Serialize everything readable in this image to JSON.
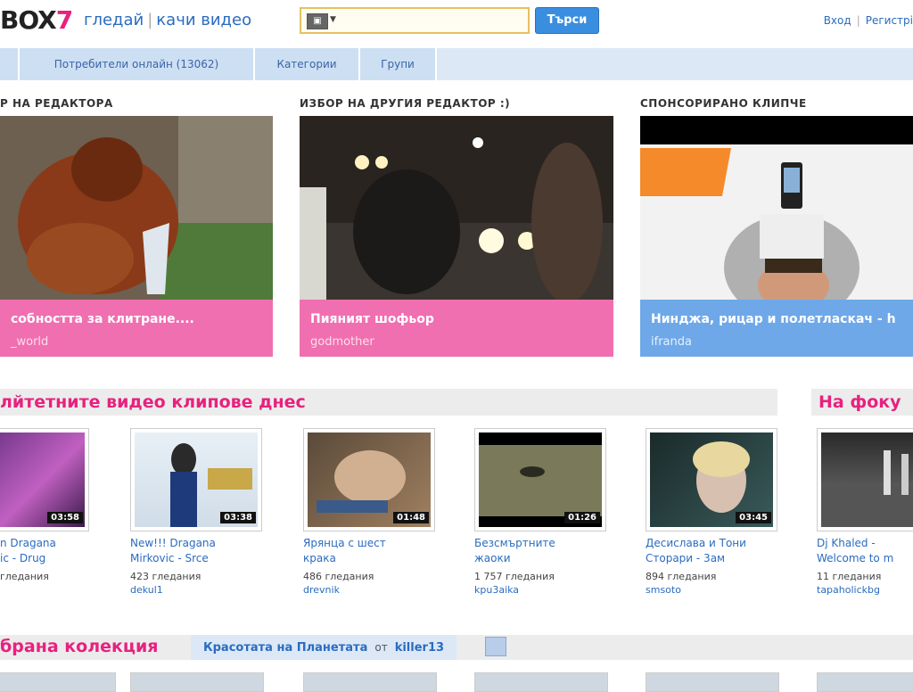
{
  "header": {
    "logo_text": "BOX",
    "logo_num": "7",
    "tag_watch": "гледай",
    "tag_upload": "качи видео",
    "search_placeholder": "",
    "search_button": "Търси",
    "login": "Вход",
    "register": "Регистрі"
  },
  "nav": {
    "tabs": [
      {
        "label": "Потребители онлайн (13062)"
      },
      {
        "label": "Категории"
      },
      {
        "label": "Групи"
      }
    ]
  },
  "featured": {
    "sections": [
      {
        "title": "Р НА РЕДАКТОРА"
      },
      {
        "title": "ИЗБОР НА ДРУГИЯ РЕДАКТОР :)"
      },
      {
        "title": "СПОНСОРИРАНО КЛИПЧЕ"
      }
    ],
    "items": [
      {
        "title": "собността за клитране....",
        "user": "_world"
      },
      {
        "title": "Пияният шофьор",
        "user": "godmother"
      },
      {
        "title": "Нинджа, рицар и полетласкач - h",
        "user": "ifranda"
      }
    ]
  },
  "popular": {
    "title": "лйтетните видео клипове днес",
    "focus_title": "На фоку"
  },
  "videos": [
    {
      "title": "n Dragana\nic - Drug",
      "views": "гледания",
      "user": "",
      "duration": "03:58"
    },
    {
      "title": "New!!! Dragana\nMirkovic - Srce",
      "views": "423 гледания",
      "user": "dekul1",
      "duration": "03:38"
    },
    {
      "title": "Ярянца с шест\nкрака",
      "views": "486 гледания",
      "user": "drevnik",
      "duration": "01:48"
    },
    {
      "title": "Безсмъртните\nжаоки",
      "views": "1 757 гледания",
      "user": "kpu3aika",
      "duration": "01:26"
    },
    {
      "title": "Десислава и Тони\nСторари - 3ам",
      "views": "894 гледания",
      "user": "smsoto",
      "duration": "03:45"
    },
    {
      "title": "Dj Khaled -\nWelcome to m",
      "views": "11 гледания",
      "user": "tapaholickbg",
      "duration": ""
    }
  ],
  "collection": {
    "title": "брана колекция",
    "name": "Красотата на Планетата",
    "by": "от",
    "author": "killer13"
  }
}
